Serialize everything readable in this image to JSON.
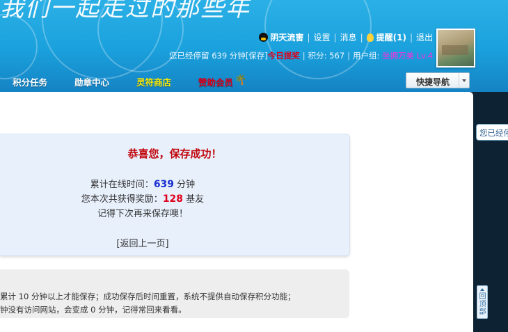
{
  "header": {
    "site_title": "我们一起走过的那些年",
    "userbar": {
      "username": "阴天流害",
      "settings": "设置",
      "messages": "消息",
      "reminder": "提醒(1)",
      "logout": "退出"
    },
    "status": {
      "stay_prefix": "您已经停留 639 分钟[保存]",
      "daily_reward": "今日提奖",
      "points_label": "积分: 567",
      "group_label": "用户组:",
      "group_name": "坐拥万美 Lv.4"
    },
    "nav": [
      "积分任务",
      "勋章中心",
      "灵符商店",
      "赞助会员"
    ],
    "quick_nav": "快捷导航"
  },
  "colors": {
    "banner": "#1aa0dc",
    "nav_normal": "#ffffff",
    "nav_shop": "#ffee00",
    "nav_vip": "#d5001c",
    "success_title": "#c2080e"
  },
  "message": {
    "title": "恭喜您，保存成功！",
    "online_prefix": "累计在线时间：",
    "online_value": "639",
    "online_unit": " 分钟",
    "reward_prefix": "您本次共获得奖励：",
    "reward_value": "128",
    "reward_unit": " 基友",
    "reminder": "记得下次再来保存噢！",
    "back_link": "[返回上一页]"
  },
  "note": {
    "line1": "累计 10 分钟以上才能保存；成功保存后时间重置，系统不提供自动保存积分功能；",
    "line2": "钟没有访问网站，会变成 0 分钟，记得常回来看看。"
  },
  "side_tab": "您已经停",
  "back_to_top": "回顶部"
}
